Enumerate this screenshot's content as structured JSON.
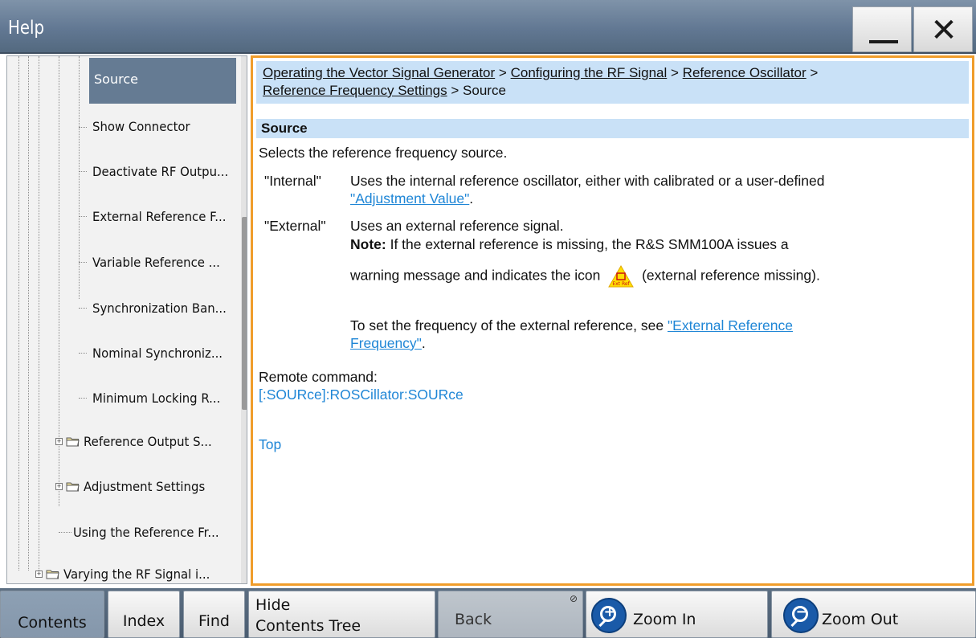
{
  "window": {
    "title": "Help",
    "minimize_icon": "minimize-icon",
    "close_icon": "close-icon"
  },
  "tree": {
    "selected": "Source",
    "items": [
      {
        "label": "Show Connector"
      },
      {
        "label": "Deactivate RF Outpu..."
      },
      {
        "label": "External Reference F..."
      },
      {
        "label": "Variable Reference ..."
      },
      {
        "label": "Synchronization Ban..."
      },
      {
        "label": "Nominal Synchroniz..."
      },
      {
        "label": "Minimum Locking R..."
      },
      {
        "label": "Reference Output S...",
        "folder": true
      },
      {
        "label": "Adjustment Settings",
        "folder": true
      },
      {
        "label": "Using the Reference Fr..."
      },
      {
        "label": "Varying the RF Signal i...",
        "folder": true
      }
    ]
  },
  "content": {
    "breadcrumb": [
      "Operating the Vector Signal Generator",
      "Configuring the RF Signal",
      "Reference Oscillator",
      "Reference Frequency Settings",
      "Source"
    ],
    "breadcrumb_separator": ">",
    "section_title": "Source",
    "intro": "Selects the reference frequency source.",
    "internal_term": "\"Internal\"",
    "internal_desc": "Uses the internal reference oscillator, either with calibrated or a user-defined",
    "internal_link": "\"Adjustment Value\"",
    "period": ".",
    "external_term": "\"External\"",
    "external_desc": "Uses an external reference signal.",
    "note_label": "Note:",
    "note_text": "If the external reference is missing, the R&S SMM100A issues a",
    "note_text2_before": "warning message and indicates the icon",
    "note_icon_caption": "Ext Ref",
    "note_text2_after": "(external reference missing).",
    "see_text": "To set the frequency of the external reference, see",
    "see_link_line1": "\"External Reference",
    "see_link_line2": "Frequency\"",
    "remote_label": "Remote command:",
    "remote_cmd": "[:SOURce]:ROSCillator:SOURce",
    "top_link": "Top"
  },
  "toolbar": {
    "contents": "Contents",
    "index": "Index",
    "find": "Find",
    "hide_line1": "Hide",
    "hide_line2": "Contents Tree",
    "back": "Back",
    "zoom_in": "Zoom In",
    "zoom_out": "Zoom Out"
  },
  "colors": {
    "titlebar": "#627893",
    "selection": "#657b93",
    "highlight_bg": "#c9e1f7",
    "link": "#1f86d6",
    "content_border": "#f09d2b",
    "zoom_icon": "#1a5aa8"
  }
}
